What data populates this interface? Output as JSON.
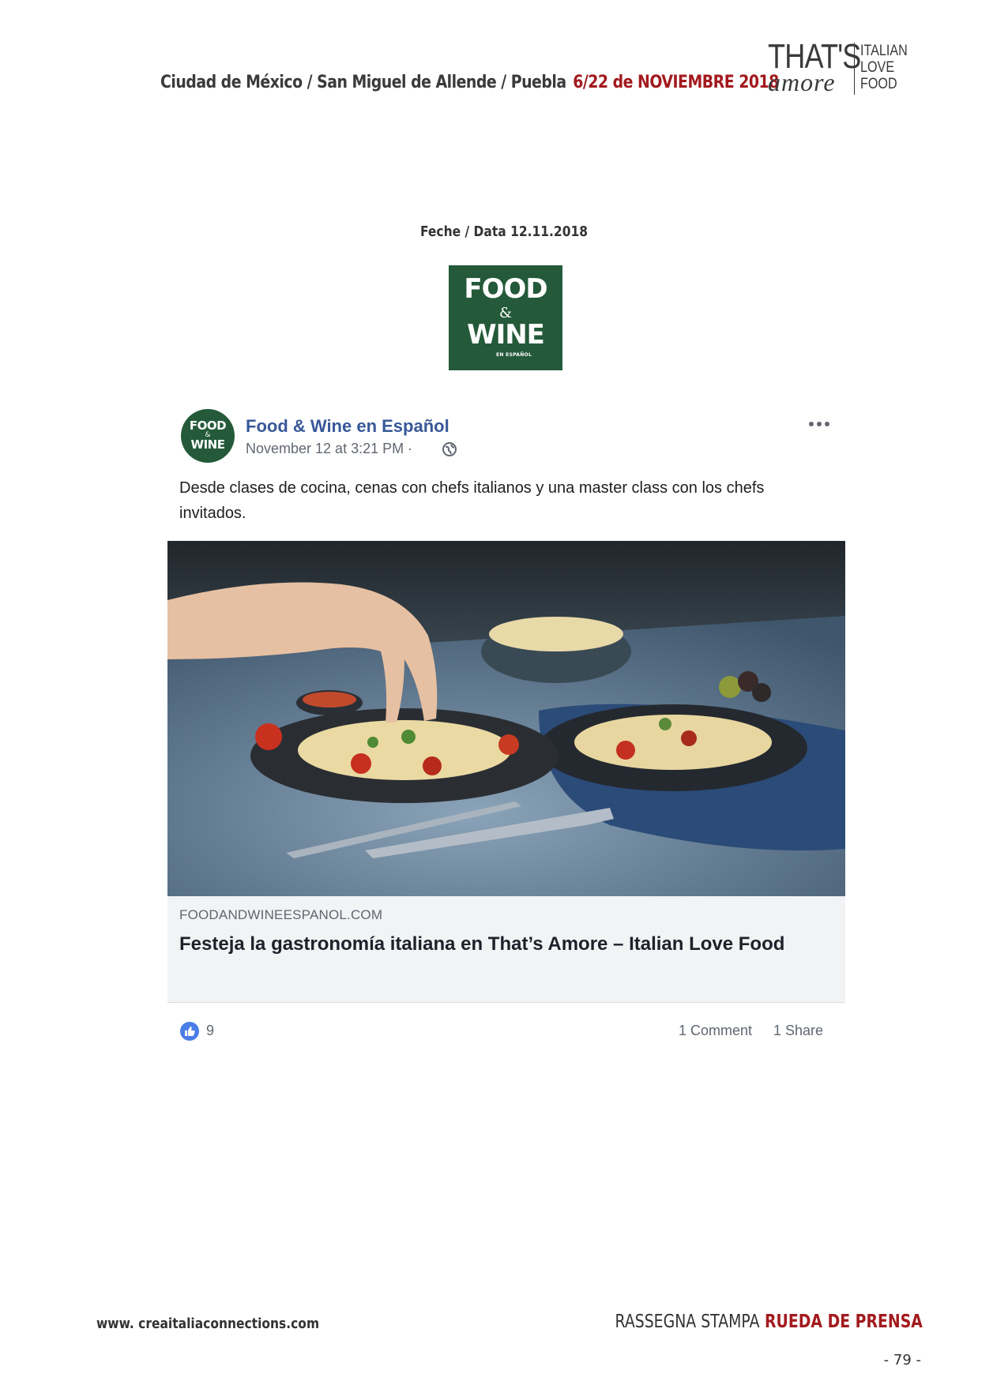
{
  "header": {
    "cities": "Ciudad de México / San Miguel de Allende / Puebla",
    "dates": "6/22 de NOVIEMBRE 2018",
    "brand": {
      "thats": "THAT'S",
      "amore": "amore",
      "line1": "ITALIAN",
      "line2": "LOVE",
      "line3": "FOOD"
    }
  },
  "date_line": "Feche / Data  12.11.2018",
  "outlet_logo": {
    "line1": "FOOD",
    "amp": "&",
    "line2": "WINE",
    "line3": "EN ESPAÑOL",
    "bg_color": "#245a3a"
  },
  "post": {
    "page_name": "Food & Wine en Español",
    "timestamp": "November 12 at 3:21 PM · ",
    "text": "Desde clases de cocina, cenas con chefs italianos y una master class con los chefs invitados.",
    "link": {
      "domain": "FOODANDWINEESPANOL.COM",
      "title": "Festeja la gastronomía italiana en That’s Amore – Italian Love Food"
    },
    "reactions": {
      "likes": "9",
      "comments": "1 Comment",
      "shares": "1 Share"
    },
    "link_color": "#385898"
  },
  "footer": {
    "url": "www. creaitaliaconnections.com",
    "label_black": "RASSEGNA STAMPA",
    "label_red": "RUEDA DE PRENSA",
    "page": "- 79 -",
    "accent_color": "#a31a1e"
  }
}
